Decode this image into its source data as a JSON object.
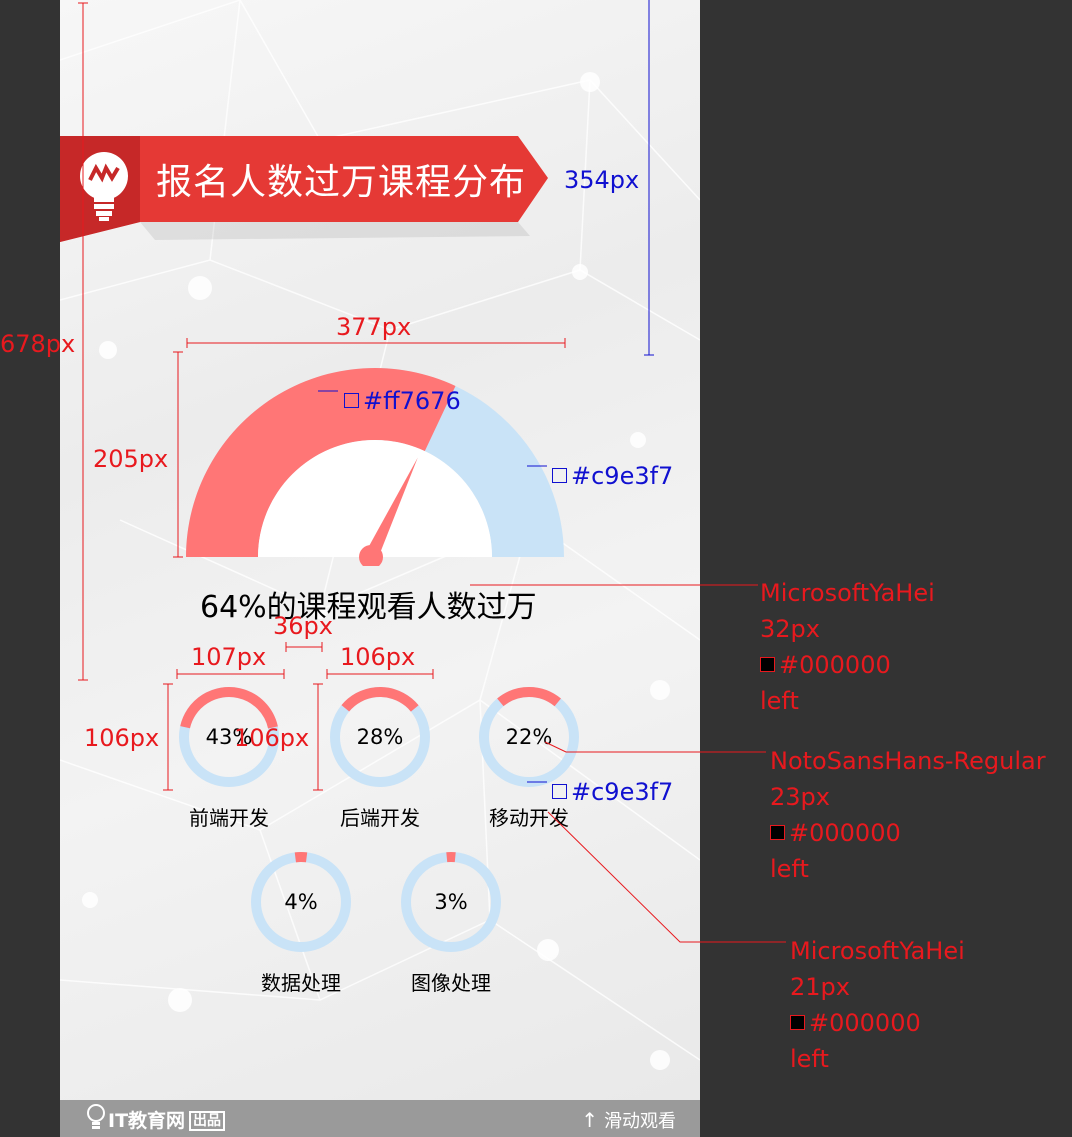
{
  "banner": {
    "title": "报名人数过万课程分布"
  },
  "gauge": {
    "value": 0.64,
    "fill_color": "#ff7676",
    "track_color": "#c9e3f7",
    "caption": "64%的课程观看人数过万"
  },
  "rings": [
    {
      "percent": 0.43,
      "label_pct": "43%",
      "name": "前端开发"
    },
    {
      "percent": 0.28,
      "label_pct": "28%",
      "name": "后端开发"
    },
    {
      "percent": 0.22,
      "label_pct": "22%",
      "name": "移动开发"
    },
    {
      "percent": 0.04,
      "label_pct": "4%",
      "name": "数据处理"
    },
    {
      "percent": 0.03,
      "label_pct": "3%",
      "name": "图像处理"
    }
  ],
  "footer": {
    "brand": "IT教育网",
    "badge": "出品",
    "scroll": "滑动观看"
  },
  "colors": {
    "banner": "#e53935",
    "accent": "#ff7676",
    "track": "#c9e3f7",
    "annotation_red": "#e8191e",
    "annotation_blue": "#1010d0"
  },
  "annotations": {
    "dim_354": "354px",
    "dim_678": "678px",
    "dim_377": "377px",
    "dim_205": "205px",
    "color_ff7676": "#ff7676",
    "color_c9e3f7_gauge": "#c9e3f7",
    "dim_36": "36px",
    "dim_107": "107px",
    "dim_106_a": "106px",
    "dim_106_b": "106px",
    "dim_106_c": "106px",
    "color_c9e3f7_ring": "#c9e3f7",
    "font_caption": {
      "family": "MicrosoftYaHei",
      "size": "32px",
      "color": "#000000",
      "align": "left"
    },
    "font_pct": {
      "family": "NotoSansHans-Regular",
      "size": "23px",
      "color": "#000000",
      "align": "left"
    },
    "font_label": {
      "family": "MicrosoftYaHei",
      "size": "21px",
      "color": "#000000",
      "align": "left"
    }
  }
}
